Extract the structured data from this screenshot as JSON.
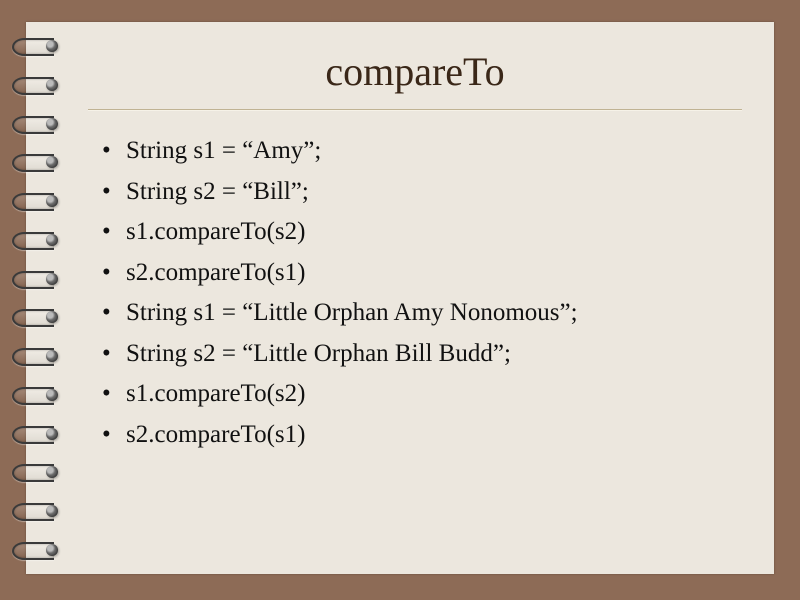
{
  "slide": {
    "title": "compareTo",
    "bullets": [
      "String s1 = “Amy”;",
      "String s2 = “Bill”;",
      "s1.compareTo(s2)",
      "s2.compareTo(s1)",
      "String s1 = “Little Orphan Amy Nonomous”;",
      "String s2 = “Little Orphan Bill Budd”;",
      "s1.compareTo(s2)",
      "s2.compareTo(s1)"
    ]
  }
}
